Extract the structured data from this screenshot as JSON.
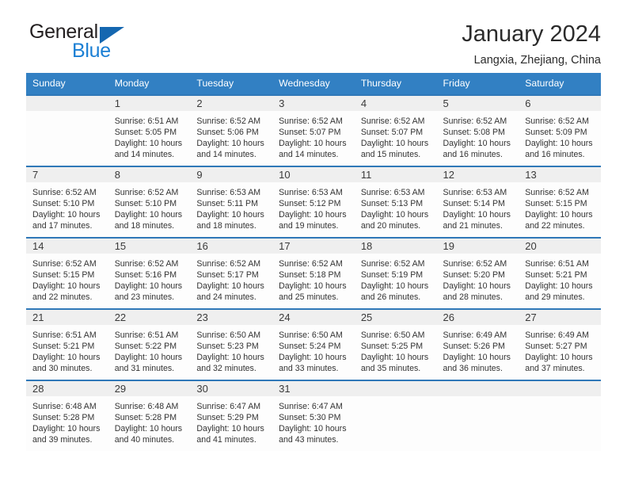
{
  "brand": {
    "name_part1": "General",
    "name_part2": "Blue",
    "triangle_icon": "triangle-icon",
    "accent_color": "#1567b0",
    "blue_text_color": "#1b7fd4"
  },
  "header": {
    "title": "January 2024",
    "subtitle": "Langxia, Zhejiang, China"
  },
  "theme": {
    "header_row_bg": "#3280c3",
    "daynum_band_bg": "#efefef",
    "row_rule_color": "#2f78b8"
  },
  "weekday_headers": [
    "Sunday",
    "Monday",
    "Tuesday",
    "Wednesday",
    "Thursday",
    "Friday",
    "Saturday"
  ],
  "labels": {
    "sunrise_prefix": "Sunrise:",
    "sunset_prefix": "Sunset:",
    "daylight_prefix": "Daylight:"
  },
  "weeks": [
    [
      {
        "day": "",
        "blank": true,
        "sunrise": "",
        "sunset": "",
        "daylight_line1": "",
        "daylight_line2": ""
      },
      {
        "day": "1",
        "blank": false,
        "sunrise": "Sunrise: 6:51 AM",
        "sunset": "Sunset: 5:05 PM",
        "daylight_line1": "Daylight: 10 hours",
        "daylight_line2": "and 14 minutes."
      },
      {
        "day": "2",
        "blank": false,
        "sunrise": "Sunrise: 6:52 AM",
        "sunset": "Sunset: 5:06 PM",
        "daylight_line1": "Daylight: 10 hours",
        "daylight_line2": "and 14 minutes."
      },
      {
        "day": "3",
        "blank": false,
        "sunrise": "Sunrise: 6:52 AM",
        "sunset": "Sunset: 5:07 PM",
        "daylight_line1": "Daylight: 10 hours",
        "daylight_line2": "and 14 minutes."
      },
      {
        "day": "4",
        "blank": false,
        "sunrise": "Sunrise: 6:52 AM",
        "sunset": "Sunset: 5:07 PM",
        "daylight_line1": "Daylight: 10 hours",
        "daylight_line2": "and 15 minutes."
      },
      {
        "day": "5",
        "blank": false,
        "sunrise": "Sunrise: 6:52 AM",
        "sunset": "Sunset: 5:08 PM",
        "daylight_line1": "Daylight: 10 hours",
        "daylight_line2": "and 16 minutes."
      },
      {
        "day": "6",
        "blank": false,
        "sunrise": "Sunrise: 6:52 AM",
        "sunset": "Sunset: 5:09 PM",
        "daylight_line1": "Daylight: 10 hours",
        "daylight_line2": "and 16 minutes."
      }
    ],
    [
      {
        "day": "7",
        "blank": false,
        "sunrise": "Sunrise: 6:52 AM",
        "sunset": "Sunset: 5:10 PM",
        "daylight_line1": "Daylight: 10 hours",
        "daylight_line2": "and 17 minutes."
      },
      {
        "day": "8",
        "blank": false,
        "sunrise": "Sunrise: 6:52 AM",
        "sunset": "Sunset: 5:10 PM",
        "daylight_line1": "Daylight: 10 hours",
        "daylight_line2": "and 18 minutes."
      },
      {
        "day": "9",
        "blank": false,
        "sunrise": "Sunrise: 6:53 AM",
        "sunset": "Sunset: 5:11 PM",
        "daylight_line1": "Daylight: 10 hours",
        "daylight_line2": "and 18 minutes."
      },
      {
        "day": "10",
        "blank": false,
        "sunrise": "Sunrise: 6:53 AM",
        "sunset": "Sunset: 5:12 PM",
        "daylight_line1": "Daylight: 10 hours",
        "daylight_line2": "and 19 minutes."
      },
      {
        "day": "11",
        "blank": false,
        "sunrise": "Sunrise: 6:53 AM",
        "sunset": "Sunset: 5:13 PM",
        "daylight_line1": "Daylight: 10 hours",
        "daylight_line2": "and 20 minutes."
      },
      {
        "day": "12",
        "blank": false,
        "sunrise": "Sunrise: 6:53 AM",
        "sunset": "Sunset: 5:14 PM",
        "daylight_line1": "Daylight: 10 hours",
        "daylight_line2": "and 21 minutes."
      },
      {
        "day": "13",
        "blank": false,
        "sunrise": "Sunrise: 6:52 AM",
        "sunset": "Sunset: 5:15 PM",
        "daylight_line1": "Daylight: 10 hours",
        "daylight_line2": "and 22 minutes."
      }
    ],
    [
      {
        "day": "14",
        "blank": false,
        "sunrise": "Sunrise: 6:52 AM",
        "sunset": "Sunset: 5:15 PM",
        "daylight_line1": "Daylight: 10 hours",
        "daylight_line2": "and 22 minutes."
      },
      {
        "day": "15",
        "blank": false,
        "sunrise": "Sunrise: 6:52 AM",
        "sunset": "Sunset: 5:16 PM",
        "daylight_line1": "Daylight: 10 hours",
        "daylight_line2": "and 23 minutes."
      },
      {
        "day": "16",
        "blank": false,
        "sunrise": "Sunrise: 6:52 AM",
        "sunset": "Sunset: 5:17 PM",
        "daylight_line1": "Daylight: 10 hours",
        "daylight_line2": "and 24 minutes."
      },
      {
        "day": "17",
        "blank": false,
        "sunrise": "Sunrise: 6:52 AM",
        "sunset": "Sunset: 5:18 PM",
        "daylight_line1": "Daylight: 10 hours",
        "daylight_line2": "and 25 minutes."
      },
      {
        "day": "18",
        "blank": false,
        "sunrise": "Sunrise: 6:52 AM",
        "sunset": "Sunset: 5:19 PM",
        "daylight_line1": "Daylight: 10 hours",
        "daylight_line2": "and 26 minutes."
      },
      {
        "day": "19",
        "blank": false,
        "sunrise": "Sunrise: 6:52 AM",
        "sunset": "Sunset: 5:20 PM",
        "daylight_line1": "Daylight: 10 hours",
        "daylight_line2": "and 28 minutes."
      },
      {
        "day": "20",
        "blank": false,
        "sunrise": "Sunrise: 6:51 AM",
        "sunset": "Sunset: 5:21 PM",
        "daylight_line1": "Daylight: 10 hours",
        "daylight_line2": "and 29 minutes."
      }
    ],
    [
      {
        "day": "21",
        "blank": false,
        "sunrise": "Sunrise: 6:51 AM",
        "sunset": "Sunset: 5:21 PM",
        "daylight_line1": "Daylight: 10 hours",
        "daylight_line2": "and 30 minutes."
      },
      {
        "day": "22",
        "blank": false,
        "sunrise": "Sunrise: 6:51 AM",
        "sunset": "Sunset: 5:22 PM",
        "daylight_line1": "Daylight: 10 hours",
        "daylight_line2": "and 31 minutes."
      },
      {
        "day": "23",
        "blank": false,
        "sunrise": "Sunrise: 6:50 AM",
        "sunset": "Sunset: 5:23 PM",
        "daylight_line1": "Daylight: 10 hours",
        "daylight_line2": "and 32 minutes."
      },
      {
        "day": "24",
        "blank": false,
        "sunrise": "Sunrise: 6:50 AM",
        "sunset": "Sunset: 5:24 PM",
        "daylight_line1": "Daylight: 10 hours",
        "daylight_line2": "and 33 minutes."
      },
      {
        "day": "25",
        "blank": false,
        "sunrise": "Sunrise: 6:50 AM",
        "sunset": "Sunset: 5:25 PM",
        "daylight_line1": "Daylight: 10 hours",
        "daylight_line2": "and 35 minutes."
      },
      {
        "day": "26",
        "blank": false,
        "sunrise": "Sunrise: 6:49 AM",
        "sunset": "Sunset: 5:26 PM",
        "daylight_line1": "Daylight: 10 hours",
        "daylight_line2": "and 36 minutes."
      },
      {
        "day": "27",
        "blank": false,
        "sunrise": "Sunrise: 6:49 AM",
        "sunset": "Sunset: 5:27 PM",
        "daylight_line1": "Daylight: 10 hours",
        "daylight_line2": "and 37 minutes."
      }
    ],
    [
      {
        "day": "28",
        "blank": false,
        "sunrise": "Sunrise: 6:48 AM",
        "sunset": "Sunset: 5:28 PM",
        "daylight_line1": "Daylight: 10 hours",
        "daylight_line2": "and 39 minutes."
      },
      {
        "day": "29",
        "blank": false,
        "sunrise": "Sunrise: 6:48 AM",
        "sunset": "Sunset: 5:28 PM",
        "daylight_line1": "Daylight: 10 hours",
        "daylight_line2": "and 40 minutes."
      },
      {
        "day": "30",
        "blank": false,
        "sunrise": "Sunrise: 6:47 AM",
        "sunset": "Sunset: 5:29 PM",
        "daylight_line1": "Daylight: 10 hours",
        "daylight_line2": "and 41 minutes."
      },
      {
        "day": "31",
        "blank": false,
        "sunrise": "Sunrise: 6:47 AM",
        "sunset": "Sunset: 5:30 PM",
        "daylight_line1": "Daylight: 10 hours",
        "daylight_line2": "and 43 minutes."
      },
      {
        "day": "",
        "blank": true,
        "sunrise": "",
        "sunset": "",
        "daylight_line1": "",
        "daylight_line2": ""
      },
      {
        "day": "",
        "blank": true,
        "sunrise": "",
        "sunset": "",
        "daylight_line1": "",
        "daylight_line2": ""
      },
      {
        "day": "",
        "blank": true,
        "sunrise": "",
        "sunset": "",
        "daylight_line1": "",
        "daylight_line2": ""
      }
    ]
  ]
}
